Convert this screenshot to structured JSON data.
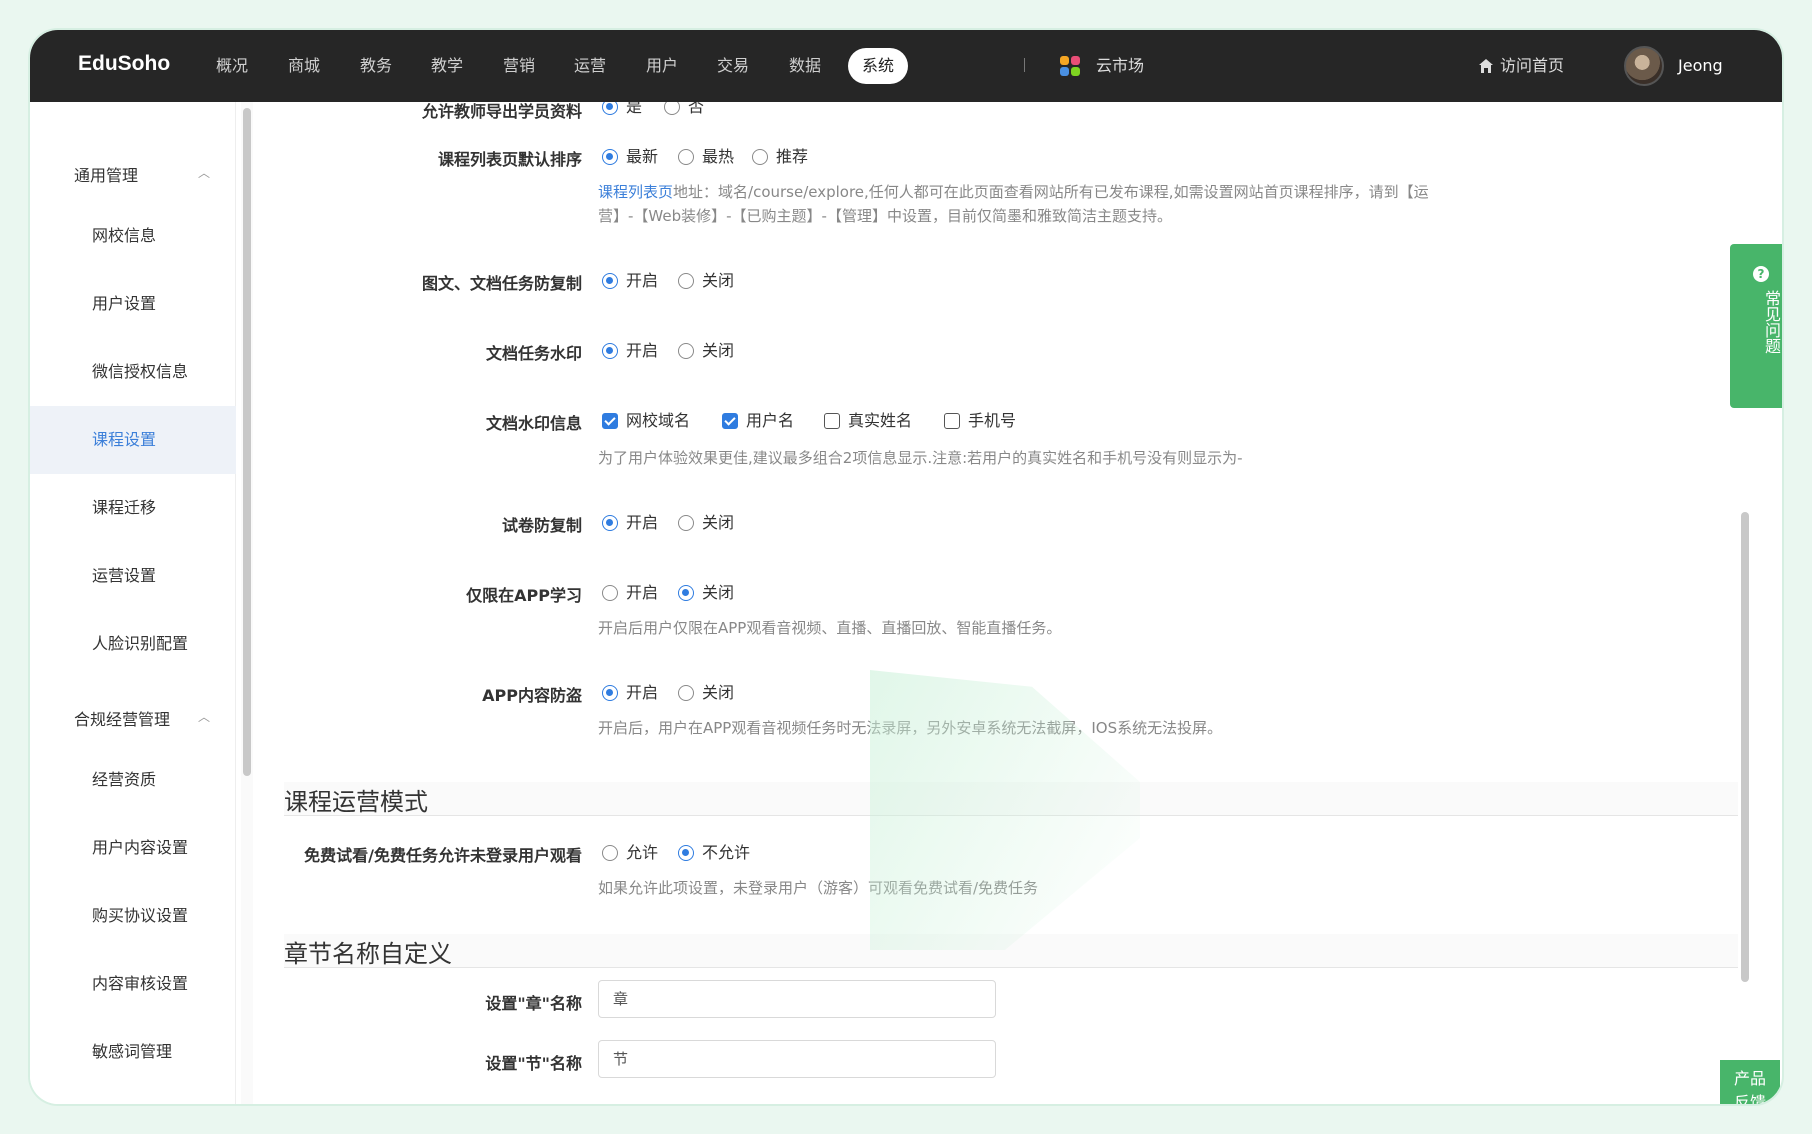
{
  "header": {
    "logo": "EduSoho",
    "nav": [
      "概况",
      "商城",
      "教务",
      "教学",
      "营销",
      "运营",
      "用户",
      "交易",
      "数据",
      "系统"
    ],
    "active_nav": "系统",
    "market": "云市场",
    "visit": "访问首页",
    "username": "Jeong"
  },
  "sidebar": {
    "group1": "通用管理",
    "group1_items": [
      "网校信息",
      "用户设置",
      "微信授权信息",
      "课程设置",
      "课程迁移",
      "运营设置",
      "人脸识别配置"
    ],
    "active_item": "课程设置",
    "group2": "合规经营管理",
    "group2_items": [
      "经营资质",
      "用户内容设置",
      "购买协议设置",
      "内容审核设置",
      "敏感词管理"
    ]
  },
  "settings": {
    "export": {
      "label": "允许教师导出学员资料",
      "opt_yes": "是",
      "opt_no": "否"
    },
    "sort": {
      "label": "课程列表页默认排序",
      "opt_new": "最新",
      "opt_hot": "最热",
      "opt_rec": "推荐",
      "help_link": "课程列表页",
      "help_line1": "地址：域名/course/explore,任何人都可在此页面查看网站所有已发布课程,如需设置网站首页课程排序，请到【运",
      "help_line2": "营】-【Web装修】-【已购主题】-【管理】中设置，目前仅简墨和雅致简洁主题支持。"
    },
    "anticopy": {
      "label": "图文、文档任务防复制",
      "opt_on": "开启",
      "opt_off": "关闭"
    },
    "watermark": {
      "label": "文档任务水印",
      "opt_on": "开启",
      "opt_off": "关闭"
    },
    "watermark_info": {
      "label": "文档水印信息",
      "opt_school": "网校域名",
      "opt_user": "用户名",
      "opt_real": "真实姓名",
      "opt_phone": "手机号",
      "help": "为了用户体验效果更佳,建议最多组合2项信息显示.注意:若用户的真实姓名和手机号没有则显示为-"
    },
    "exam_copy": {
      "label": "试卷防复制",
      "opt_on": "开启",
      "opt_off": "关闭"
    },
    "app_only": {
      "label": "仅限在APP学习",
      "opt_on": "开启",
      "opt_off": "关闭",
      "help": "开启后用户仅限在APP观看音视频、直播、直播回放、智能直播任务。"
    },
    "app_guard": {
      "label": "APP内容防盗",
      "opt_on": "开启",
      "opt_off": "关闭",
      "help": "开启后，用户在APP观看音视频任务时无法录屏，另外安卓系统无法截屏，IOS系统无法投屏。"
    }
  },
  "section_mode": {
    "title": "课程运营模式",
    "free": {
      "label": "免费试看/免费任务允许未登录用户观看",
      "opt_allow": "允许",
      "opt_deny": "不允许",
      "help": "如果允许此项设置，未登录用户（游客）可观看免费试看/免费任务"
    }
  },
  "section_chapter": {
    "title": "章节名称自定义",
    "chapter_label": "设置\"章\"名称",
    "chapter_value": "章",
    "section_label": "设置\"节\"名称",
    "section_value": "节"
  },
  "float": {
    "faq_icon": "?",
    "faq": "常见问题",
    "feedback_line1": "产品",
    "feedback_line2": "反馈"
  }
}
